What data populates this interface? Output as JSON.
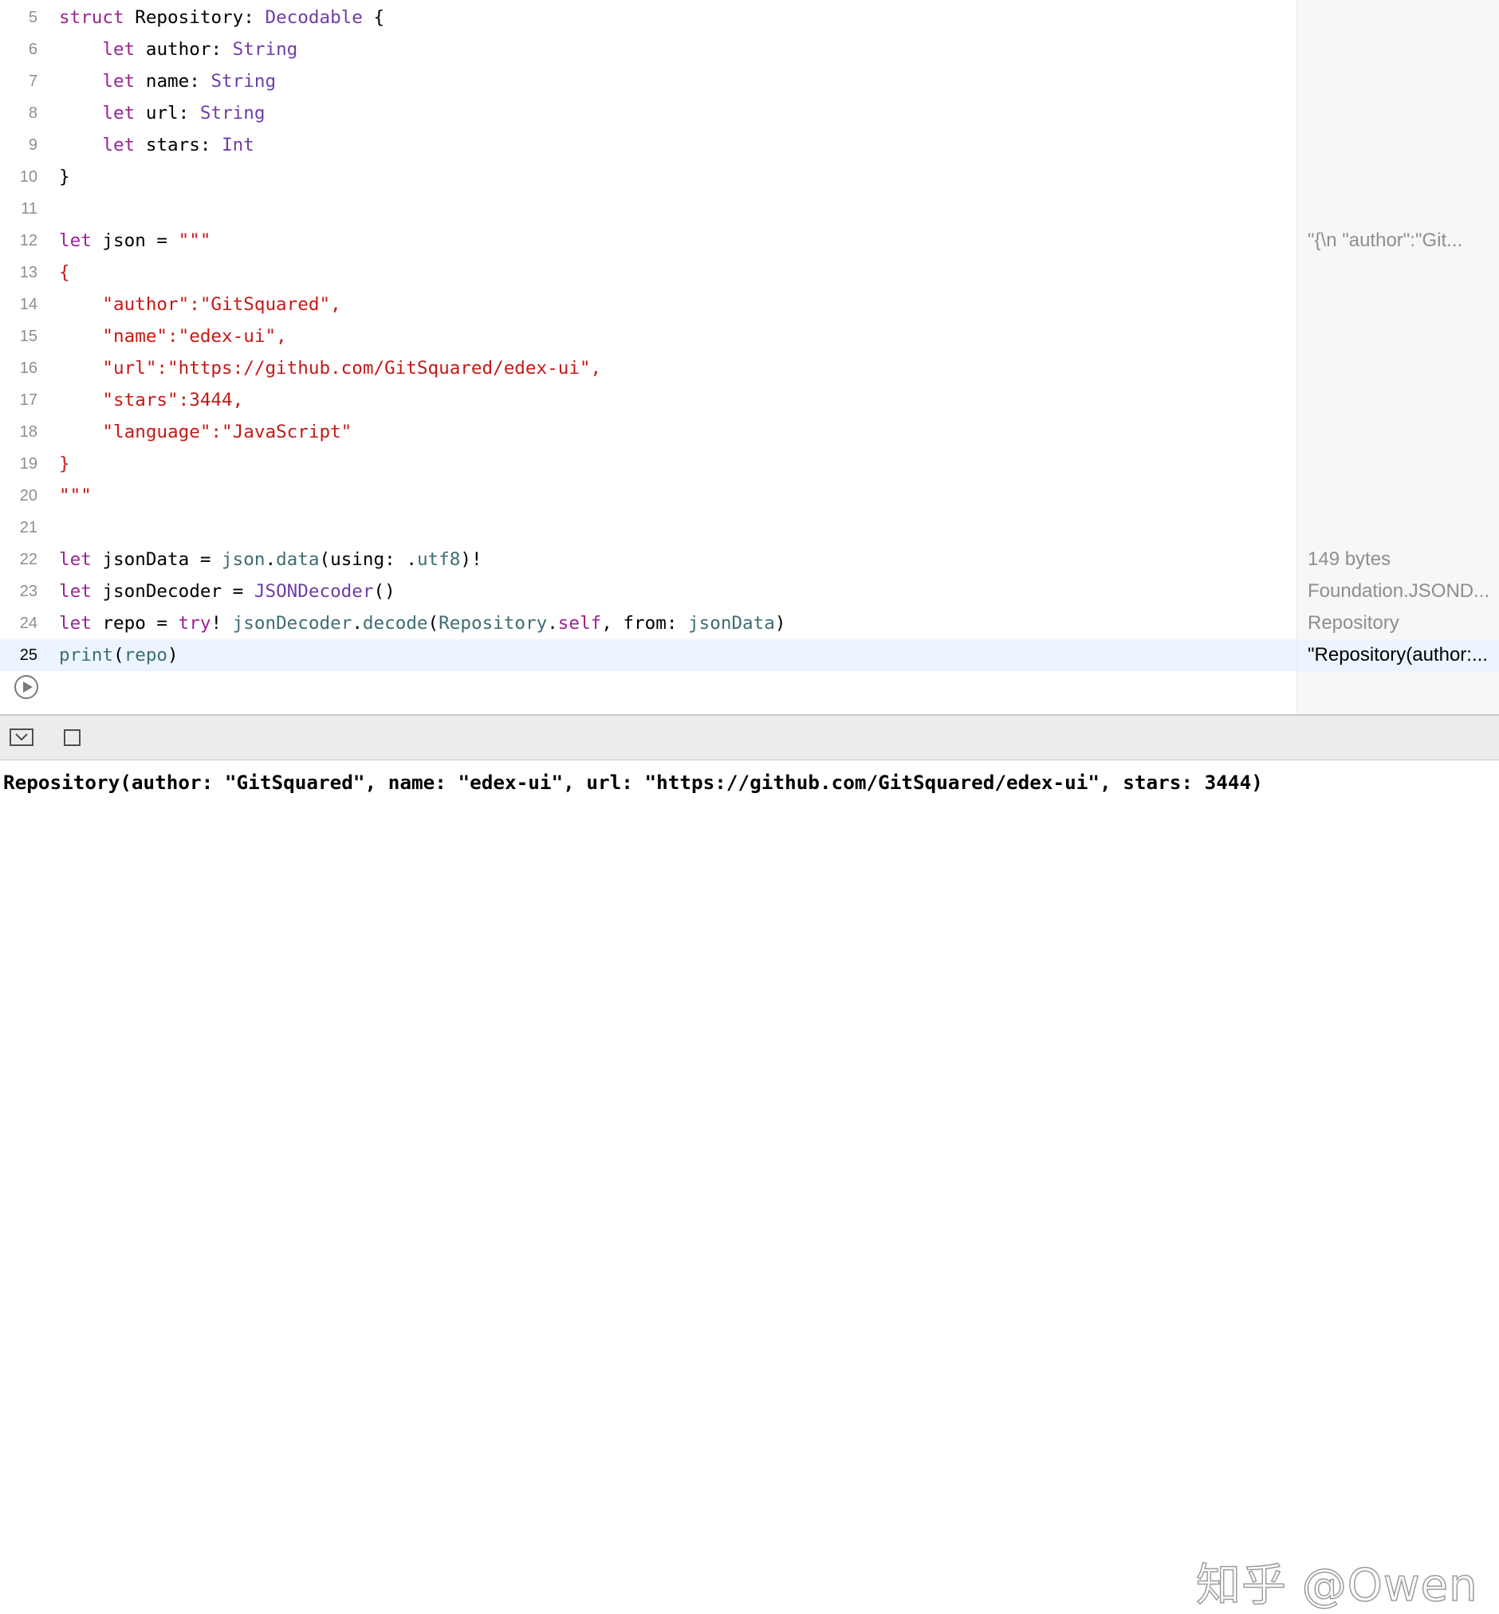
{
  "editor": {
    "lines": [
      {
        "no": "5",
        "tokens": [
          {
            "t": "struct",
            "c": "kw"
          },
          {
            "t": " Repository: ",
            "c": ""
          },
          {
            "t": "Decodable",
            "c": "ty"
          },
          {
            "t": " {",
            "c": ""
          }
        ]
      },
      {
        "no": "6",
        "tokens": [
          {
            "t": "    ",
            "c": ""
          },
          {
            "t": "let",
            "c": "kw"
          },
          {
            "t": " author: ",
            "c": ""
          },
          {
            "t": "String",
            "c": "ty"
          }
        ]
      },
      {
        "no": "7",
        "tokens": [
          {
            "t": "    ",
            "c": ""
          },
          {
            "t": "let",
            "c": "kw"
          },
          {
            "t": " name: ",
            "c": ""
          },
          {
            "t": "String",
            "c": "ty"
          }
        ]
      },
      {
        "no": "8",
        "tokens": [
          {
            "t": "    ",
            "c": ""
          },
          {
            "t": "let",
            "c": "kw"
          },
          {
            "t": " url: ",
            "c": ""
          },
          {
            "t": "String",
            "c": "ty"
          }
        ]
      },
      {
        "no": "9",
        "tokens": [
          {
            "t": "    ",
            "c": ""
          },
          {
            "t": "let",
            "c": "kw"
          },
          {
            "t": " stars: ",
            "c": ""
          },
          {
            "t": "Int",
            "c": "ty"
          }
        ]
      },
      {
        "no": "10",
        "tokens": [
          {
            "t": "}",
            "c": ""
          }
        ]
      },
      {
        "no": "11",
        "tokens": []
      },
      {
        "no": "12",
        "tokens": [
          {
            "t": "let",
            "c": "kw"
          },
          {
            "t": " json = ",
            "c": ""
          },
          {
            "t": "\"\"\"",
            "c": "str"
          }
        ]
      },
      {
        "no": "13",
        "tokens": [
          {
            "t": "{",
            "c": "str"
          }
        ]
      },
      {
        "no": "14",
        "tokens": [
          {
            "t": "    \"author\":\"GitSquared\",",
            "c": "str"
          }
        ]
      },
      {
        "no": "15",
        "tokens": [
          {
            "t": "    \"name\":\"edex-ui\",",
            "c": "str"
          }
        ]
      },
      {
        "no": "16",
        "tokens": [
          {
            "t": "    \"url\":\"https://github.com/GitSquared/edex-ui\",",
            "c": "str"
          }
        ]
      },
      {
        "no": "17",
        "tokens": [
          {
            "t": "    \"stars\":3444,",
            "c": "str"
          }
        ]
      },
      {
        "no": "18",
        "tokens": [
          {
            "t": "    \"language\":\"JavaScript\"",
            "c": "str"
          }
        ]
      },
      {
        "no": "19",
        "tokens": [
          {
            "t": "}",
            "c": "str"
          }
        ]
      },
      {
        "no": "20",
        "tokens": [
          {
            "t": "\"\"\"",
            "c": "str"
          }
        ]
      },
      {
        "no": "21",
        "tokens": []
      },
      {
        "no": "22",
        "tokens": [
          {
            "t": "let",
            "c": "kw"
          },
          {
            "t": " jsonData = ",
            "c": ""
          },
          {
            "t": "json",
            "c": "fn"
          },
          {
            "t": ".",
            "c": ""
          },
          {
            "t": "data",
            "c": "fn"
          },
          {
            "t": "(using: .",
            "c": ""
          },
          {
            "t": "utf8",
            "c": "fn"
          },
          {
            "t": ")!",
            "c": ""
          }
        ]
      },
      {
        "no": "23",
        "tokens": [
          {
            "t": "let",
            "c": "kw"
          },
          {
            "t": " jsonDecoder = ",
            "c": ""
          },
          {
            "t": "JSONDecoder",
            "c": "ty"
          },
          {
            "t": "()",
            "c": ""
          }
        ]
      },
      {
        "no": "24",
        "tokens": [
          {
            "t": "let",
            "c": "kw"
          },
          {
            "t": " repo = ",
            "c": ""
          },
          {
            "t": "try",
            "c": "kw"
          },
          {
            "t": "! ",
            "c": ""
          },
          {
            "t": "jsonDecoder",
            "c": "fn"
          },
          {
            "t": ".",
            "c": ""
          },
          {
            "t": "decode",
            "c": "fn"
          },
          {
            "t": "(",
            "c": ""
          },
          {
            "t": "Repository",
            "c": "fn"
          },
          {
            "t": ".",
            "c": ""
          },
          {
            "t": "self",
            "c": "kw"
          },
          {
            "t": ", from: ",
            "c": ""
          },
          {
            "t": "jsonData",
            "c": "fn"
          },
          {
            "t": ")",
            "c": ""
          }
        ]
      },
      {
        "no": "25",
        "current": true,
        "tokens": [
          {
            "t": "print",
            "c": "fn"
          },
          {
            "t": "(",
            "c": ""
          },
          {
            "t": "repo",
            "c": "fn"
          },
          {
            "t": ")",
            "c": ""
          }
        ]
      }
    ]
  },
  "results_sidebar": {
    "items": [
      {
        "line": "12",
        "text": "\"{\\n    \"author\":\"Git..."
      },
      {
        "line": "22",
        "text": "149 bytes"
      },
      {
        "line": "23",
        "text": "Foundation.JSOND..."
      },
      {
        "line": "24",
        "text": "Repository"
      },
      {
        "line": "25",
        "text": "\"Repository(author:...",
        "current": true
      }
    ]
  },
  "run_button": {
    "icon": "play-icon"
  },
  "debug_bar": {
    "hide_icon": "hide-debug-area-icon",
    "toggle_icon": "square-icon"
  },
  "console": {
    "output": "Repository(author: \"GitSquared\", name: \"edex-ui\", url: \"https://github.com/GitSquared/edex-ui\", stars: 3444)"
  },
  "watermark": {
    "text": "知乎 @Owen"
  },
  "colors": {
    "keyword": "#9b2393",
    "type": "#703daa",
    "identifier": "#3e6d74",
    "string": "#c41a16",
    "current_line": "#ecf5ff",
    "gutter": "#8e8e8e"
  }
}
